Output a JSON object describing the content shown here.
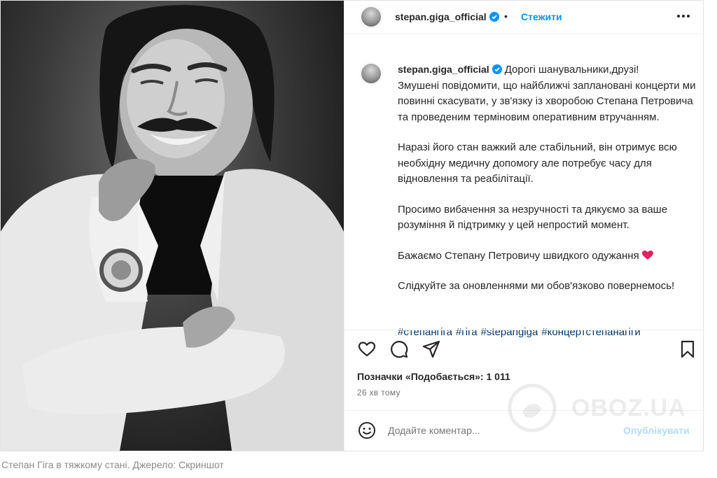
{
  "post": {
    "username": "stepan.giga_official",
    "follow_label": "Стежити",
    "dot": "•",
    "caption": {
      "username": "stepan.giga_official",
      "paragraphs": [
        "Дорогі шанувальники,друзі!\nЗмушені повідомити, що найближчі заплановані концерти ми повинні скасувати, у зв'язку із хворобою Степана Петровича та проведеним терміновим оперативним втручанням.",
        "Наразі його стан важкий але стабільний, він отримує всю необхідну медичну допомогу але потребує часу для відновлення та реабілітації.",
        "Просимо вибачення за незручності та дякуємо за ваше розуміння й підтримку у цей непростий момент.",
        "Бажаємо Степану Петровичу швидкого одужання",
        "Слідкуйте за оновленнями ми обов'язково повернемось!"
      ],
      "hashtags": [
        "#степангіга",
        "#гіга",
        "#stepangiga",
        "#концертстепанагіги"
      ]
    },
    "likes": "Позначки «Подобається»: 1 011",
    "time": "26 хв тому",
    "comment_placeholder": "Додайте коментар...",
    "publish_label": "Опублікувати",
    "icons": [
      "heart-icon",
      "comment-icon",
      "share-icon",
      "bookmark-icon",
      "more-icon",
      "emoji-icon",
      "verified-badge-icon"
    ],
    "colors": {
      "link": "#0095f6",
      "hashtag": "#00376b",
      "publish_disabled": "#b3dbff",
      "heart": "#e0245e"
    }
  },
  "watermark": "OBOZ.UA",
  "credit": "Степан Гіга в тяжкому стані. Джерело: Скриншот"
}
